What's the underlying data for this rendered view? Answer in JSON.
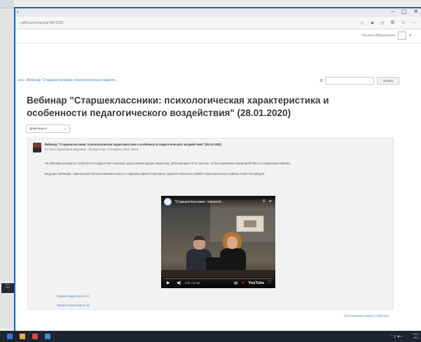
{
  "desktop": {
    "clock_time": "21:4",
    "clock_date": "10.0"
  },
  "browser": {
    "url": "...rd/forum/view.php?id=1520",
    "window_controls": [
      "–",
      "▢",
      "✕"
    ],
    "toolbar_icons": [
      "star-icon",
      "extension-icon",
      "bookmark-icon",
      "collections-icon",
      "profile-icon",
      "menu-icon"
    ]
  },
  "site": {
    "user_name": "Татьяна Афанасьева"
  },
  "breadcrumb": "...кса › Вебинар \"Старшеклассники: психологическая характе...",
  "search": {
    "placeholder": "",
    "button": "Искать"
  },
  "page_title": "Вебинар \"Старшеклассники: психологическая характеристика и особенности педагогического воздействия\" (28.01.2020)",
  "display_mode": "Древовидно",
  "post": {
    "subject": "Вебинар \"Старшеклассники: психологическая характеристика и особенности педагогического воздействия\" (28.01.2020)",
    "author_prefix": "от",
    "author": "Ольга Борисовна Кедулина",
    "date": "Воскресенье, 9 Февраль 2020, 08:24",
    "paragraph1": "На вебинаре раскрыты особенности подростков и юношей, даны рекомендации педагогам, работающим в 8-11 классах, по выстраиванию взаимодействия со старшеклассниками.",
    "paragraph2": "Ведущие вебинара: Афанасьева Татьяна Иннокентьевна и Сидорова Ирина Сергеевна, педагоги-психологи ЦПМСС Красносельского района Санкт-Петербурга",
    "video": {
      "title": "\"Старшеклассники: психолог...",
      "time": "0:00 / 57:08",
      "brand": "YouTube"
    },
    "attachments": [
      "Презентация (часть 1)",
      "Презентация (часть 2)"
    ],
    "permalink": "Постоянная ссылка",
    "reply": "Ответить"
  },
  "colors": {
    "accent": "#1565c0",
    "link": "#4d7fb5",
    "taskbar": "#1e2430"
  }
}
